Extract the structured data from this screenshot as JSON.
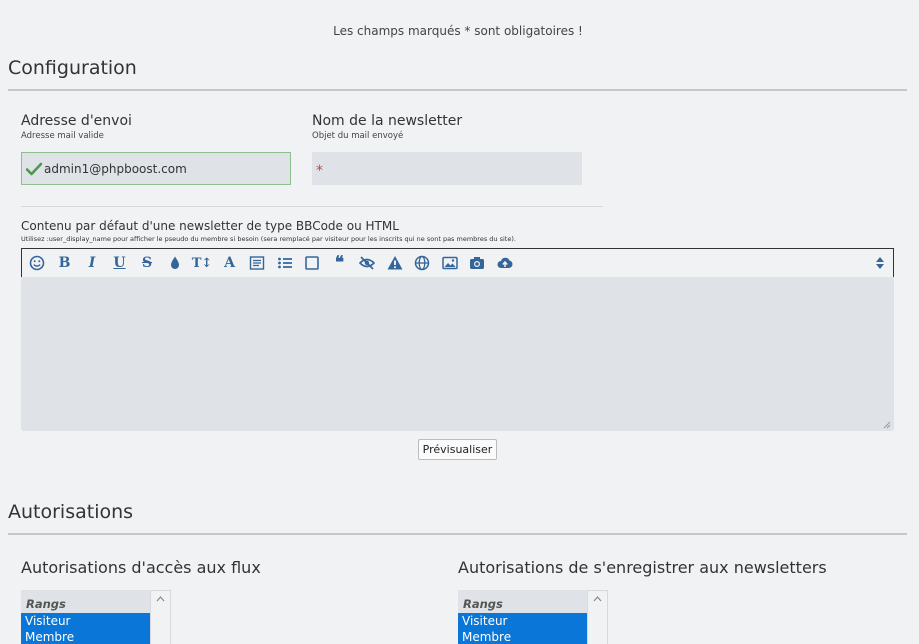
{
  "notice": "Les champs marqués * sont obligatoires !",
  "configuration": {
    "title": "Configuration",
    "sender": {
      "label": "Adresse d'envoi",
      "sublabel": "Adresse mail valide",
      "value": "admin1@phpboost.com"
    },
    "newsletter_name": {
      "label": "Nom de la newsletter",
      "sublabel": "Objet du mail envoyé",
      "required_mark": "*",
      "value": ""
    },
    "content": {
      "label": "Contenu par défaut d'une newsletter de type BBCode ou HTML",
      "help": "Utilisez :user_display_name pour afficher le pseudo du membre si besoin (sera remplacé par visiteur pour les inscrits qui ne sont pas membres du site).",
      "value": ""
    },
    "toolbar": [
      {
        "name": "smiley-icon"
      },
      {
        "name": "bold-icon",
        "glyph": "B"
      },
      {
        "name": "italic-icon",
        "glyph": "I"
      },
      {
        "name": "underline-icon",
        "glyph": "U"
      },
      {
        "name": "strikethrough-icon",
        "glyph": "S"
      },
      {
        "name": "color-drop-icon"
      },
      {
        "name": "text-size-icon",
        "glyph": "T↕"
      },
      {
        "name": "font-icon",
        "glyph": "A"
      },
      {
        "name": "paragraph-icon"
      },
      {
        "name": "list-icon"
      },
      {
        "name": "block-icon"
      },
      {
        "name": "quote-icon",
        "glyph": "❝"
      },
      {
        "name": "hide-icon"
      },
      {
        "name": "warning-icon"
      },
      {
        "name": "globe-icon"
      },
      {
        "name": "image-icon"
      },
      {
        "name": "camera-icon"
      },
      {
        "name": "upload-cloud-icon"
      }
    ],
    "preview_label": "Prévisualiser"
  },
  "authorizations": {
    "title": "Autorisations",
    "feed_access": {
      "label": "Autorisations d'accès aux flux",
      "group_label": "Rangs",
      "options": [
        "Visiteur",
        "Membre"
      ]
    },
    "subscribe": {
      "label": "Autorisations de s'enregistrer aux newsletters",
      "group_label": "Rangs",
      "options": [
        "Visiteur",
        "Membre"
      ]
    }
  },
  "colors": {
    "accent": "#35669b",
    "selected": "#0a76d8",
    "valid": "#4a9a4a",
    "required": "#c0464a"
  }
}
